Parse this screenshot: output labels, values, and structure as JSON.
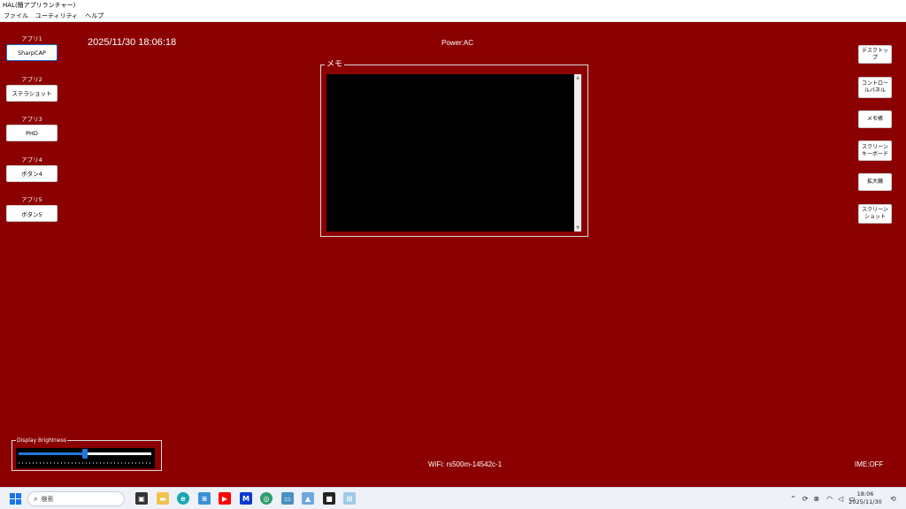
{
  "window": {
    "title": "HAL(簡アプリランチャー)"
  },
  "menubar": {
    "items": [
      "ファイル",
      "ユーティリティ",
      "ヘルプ"
    ]
  },
  "apps": [
    {
      "label": "アプリ1",
      "button": "SharpCAP"
    },
    {
      "label": "アプリ2",
      "button": "ステラショット"
    },
    {
      "label": "アプリ3",
      "button": "PHD"
    },
    {
      "label": "アプリ4",
      "button": "ボタン4"
    },
    {
      "label": "アプリ5",
      "button": "ボタン5"
    }
  ],
  "datetime": "2025/11/30 18:06:18",
  "power": "Power:AC",
  "memo": {
    "legend": "メモ",
    "text": ""
  },
  "tools": [
    "デスクトップ",
    "コントロールパネル",
    "メモ帳",
    "スクリーンキーボード",
    "拡大鏡",
    "スクリーンショット"
  ],
  "brightness": {
    "legend": "Display Brightness",
    "value_fraction": 0.5
  },
  "wifi": "WiFi: rs500m-14542c-1",
  "ime": "IME:OFF",
  "taskbar": {
    "search_placeholder": "検索",
    "clock_time": "18:06",
    "clock_date": "2025/11/30",
    "pinned": [
      "task-view-icon",
      "file-explorer-icon",
      "edge-icon",
      "notepad-icon",
      "youtube-icon",
      "malwarebytes-icon",
      "browser-icon",
      "remote-desktop-icon",
      "photos-icon",
      "sticky-notes-icon",
      "hal-launcher-icon"
    ],
    "tray": [
      "chevron-up-icon",
      "sync-icon",
      "close-circle-icon",
      "wifi-icon",
      "volume-icon",
      "battery-icon",
      "notification-icon"
    ]
  },
  "colors": {
    "background": "#8b0000",
    "accent": "#1e78d8",
    "taskbar": "#eef1f7"
  }
}
